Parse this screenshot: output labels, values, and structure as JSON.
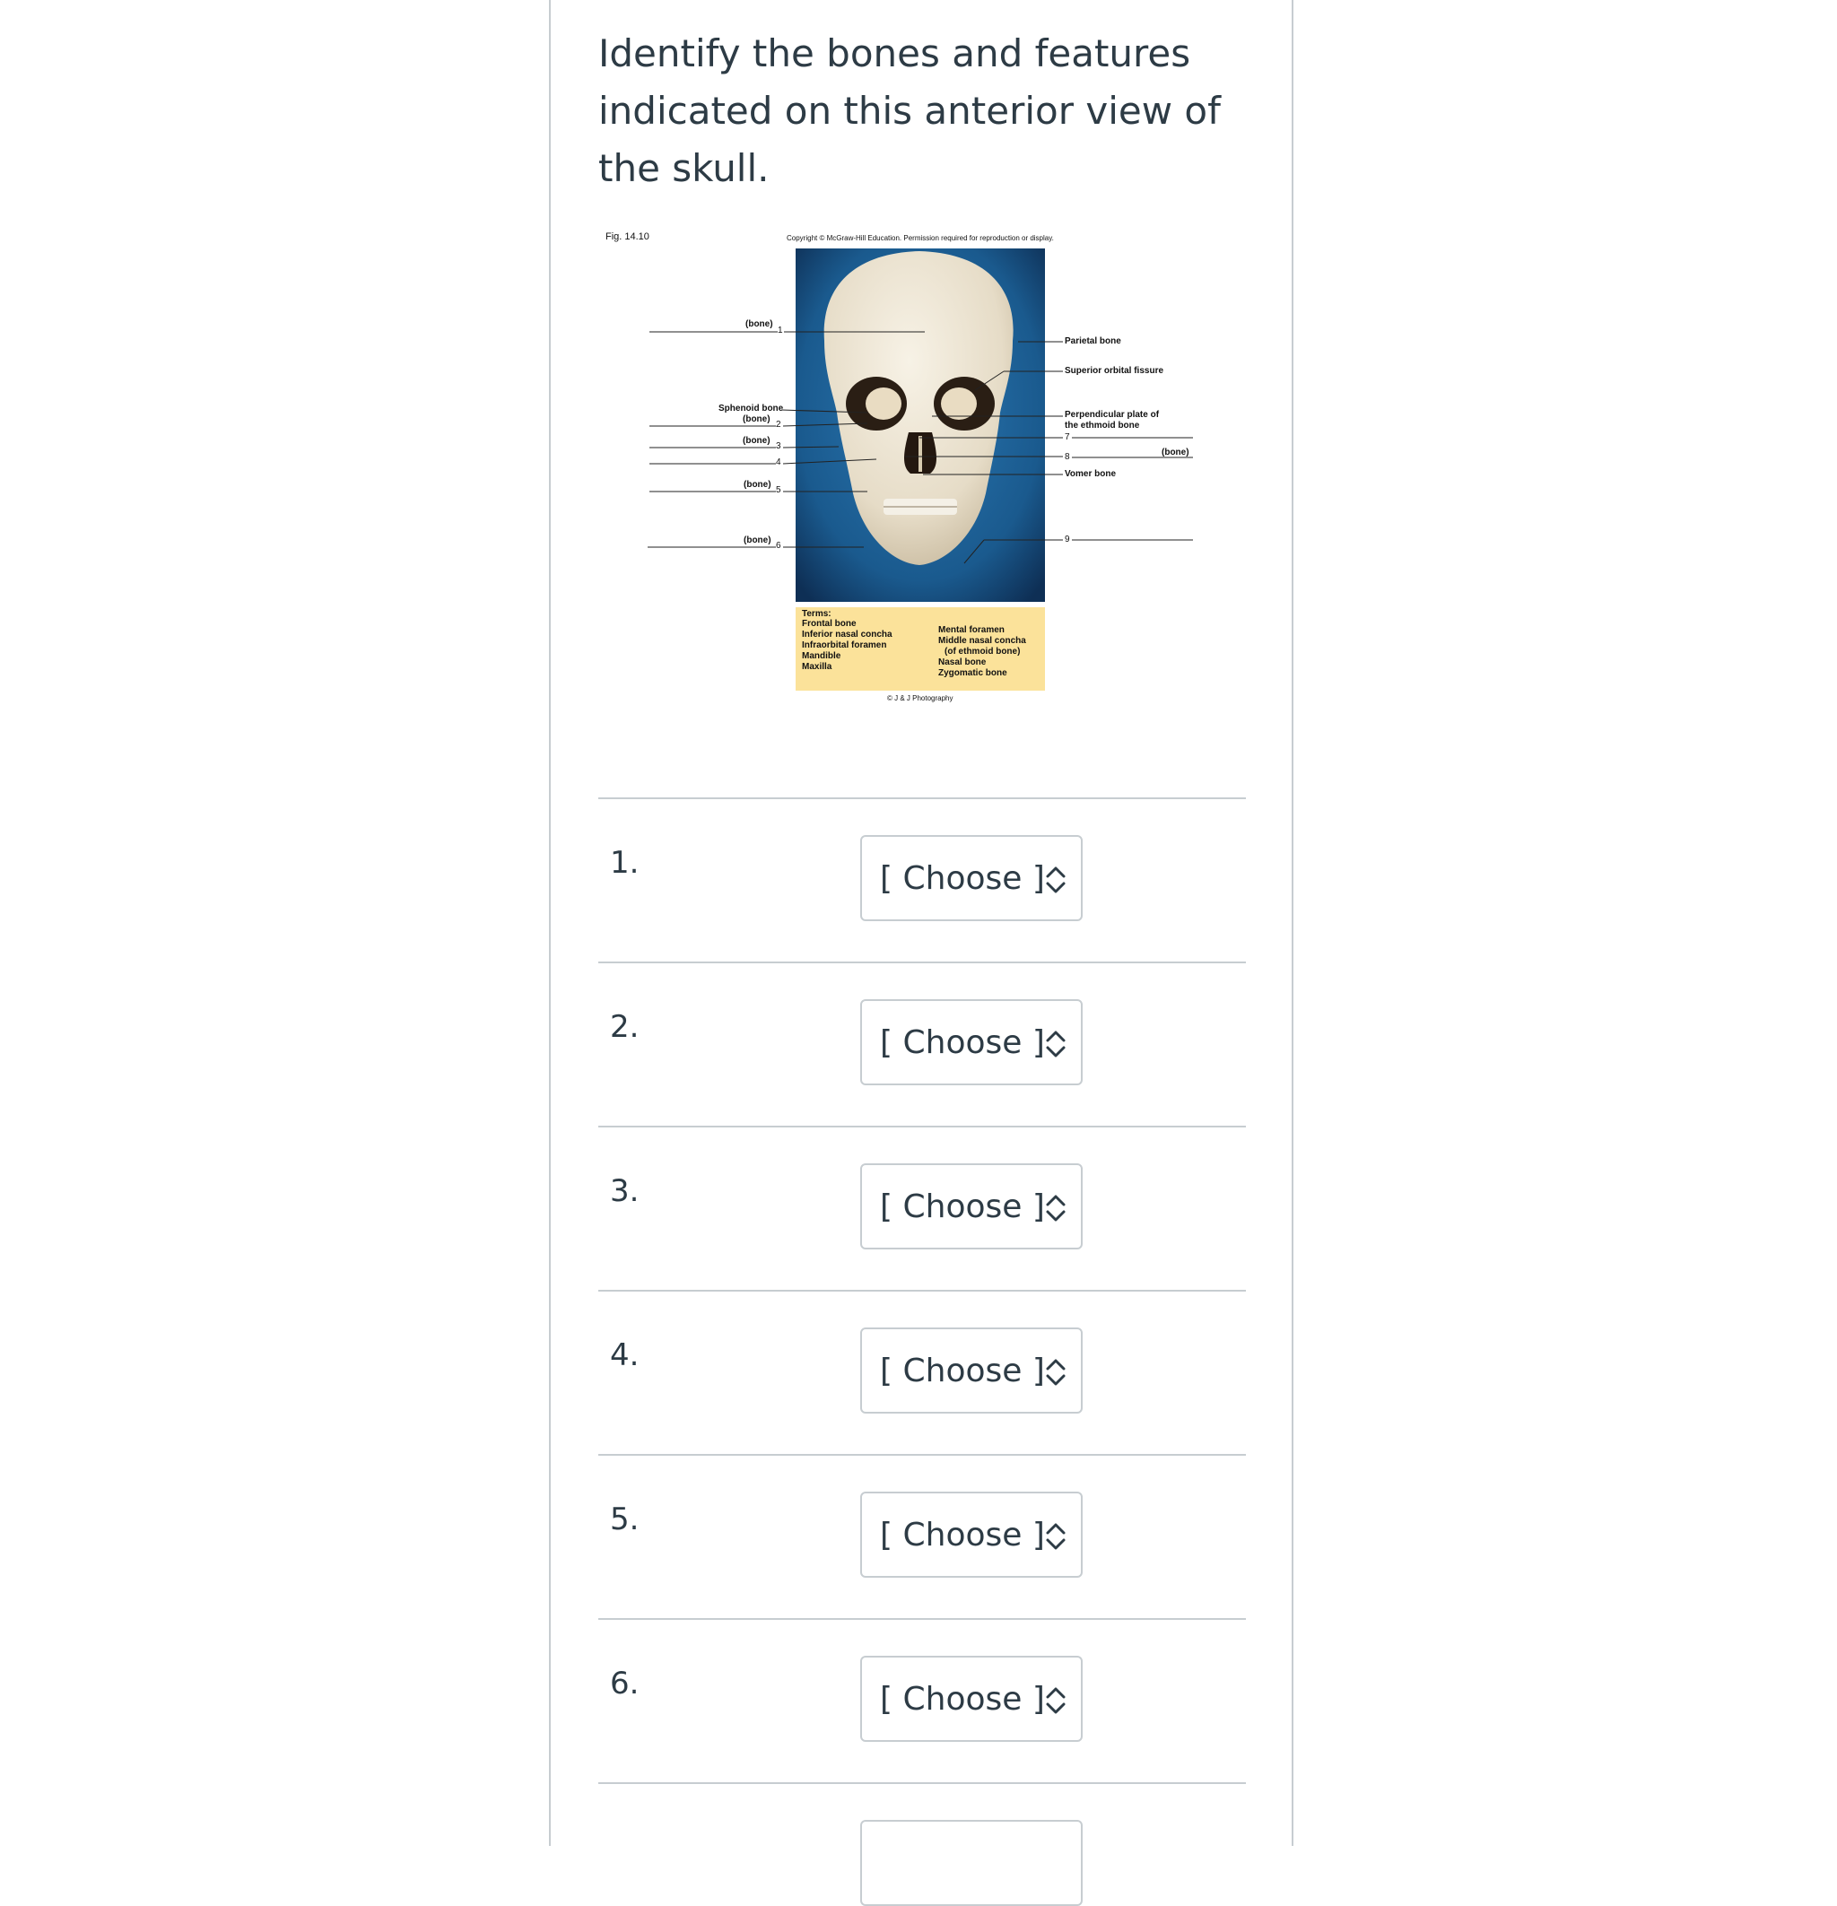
{
  "question": {
    "text": "Identify the bones and features indicated on this anterior view of the skull."
  },
  "figure": {
    "fig_number": "Fig. 14.10",
    "copyright": "Copyright © McGraw-Hill Education. Permission required for reproduction or display.",
    "credit": "© J & J Photography",
    "left_labels": [
      {
        "text": "(bone)",
        "num": "1"
      },
      {
        "text": "Sphenoid bone",
        "num": ""
      },
      {
        "text": "(bone)",
        "num": "2"
      },
      {
        "text": "(bone)",
        "num": "3"
      },
      {
        "text": "",
        "num": "4"
      },
      {
        "text": "(bone)",
        "num": "5"
      },
      {
        "text": "(bone)",
        "num": "6"
      }
    ],
    "right_labels": [
      {
        "text": "Parietal bone"
      },
      {
        "text": "Superior orbital fissure"
      },
      {
        "text": "Perpendicular plate of"
      },
      {
        "text": "the ethmoid bone"
      },
      {
        "num": "7"
      },
      {
        "num": "8",
        "text": "(bone)"
      },
      {
        "text": "Vomer bone"
      },
      {
        "num": "9"
      }
    ],
    "terms_title": "Terms:",
    "terms_left": [
      "Frontal bone",
      "Inferior nasal concha",
      "Infraorbital foramen",
      "Mandible",
      "Maxilla"
    ],
    "terms_right": [
      "Mental foramen",
      "Middle nasal concha",
      "(of ethmoid bone)",
      "Nasal bone",
      "Zygomatic bone"
    ],
    "colors": {
      "background": "#1d5e93",
      "skull": "#eee6d6",
      "terms_box": "#fbe29a"
    }
  },
  "answers": [
    {
      "number": "1.",
      "select_value": "[ Choose ]"
    },
    {
      "number": "2.",
      "select_value": "[ Choose ]"
    },
    {
      "number": "3.",
      "select_value": "[ Choose ]"
    },
    {
      "number": "4.",
      "select_value": "[ Choose ]"
    },
    {
      "number": "5.",
      "select_value": "[ Choose ]"
    },
    {
      "number": "6.",
      "select_value": "[ Choose ]"
    }
  ]
}
